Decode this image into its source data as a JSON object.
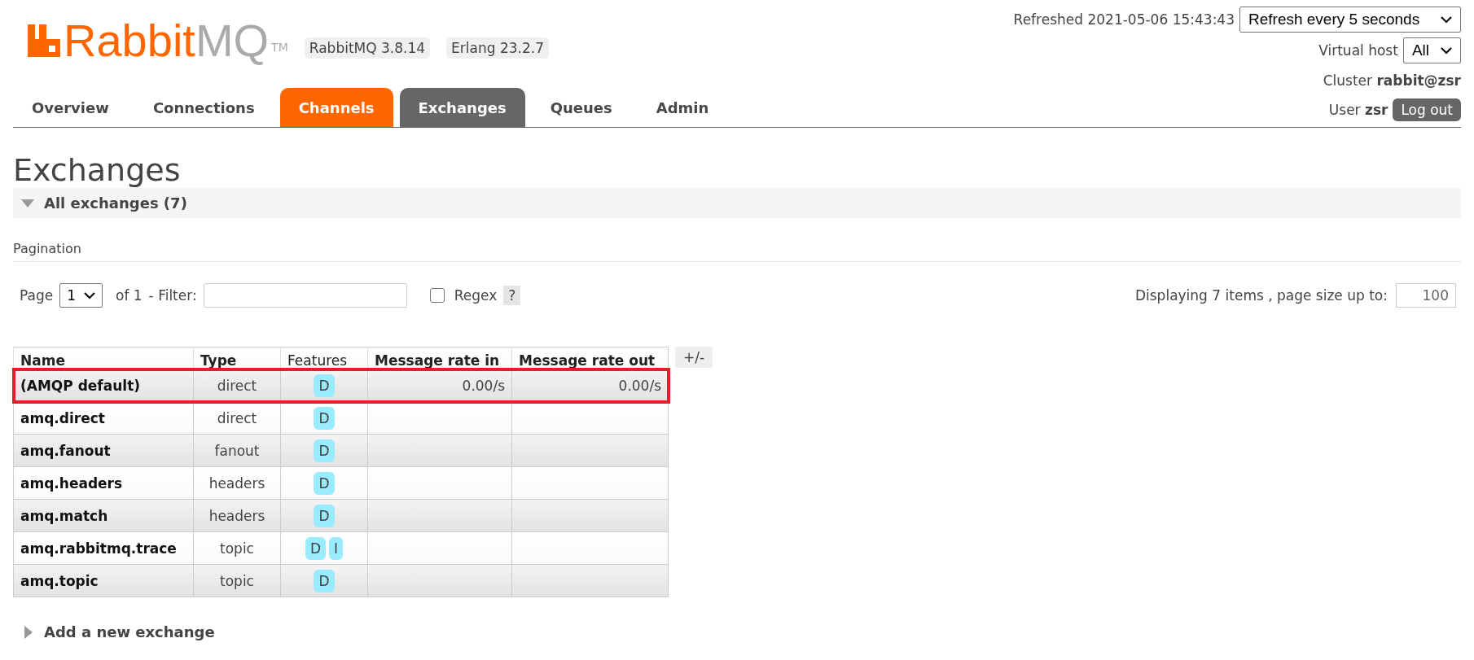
{
  "header": {
    "logo": {
      "brand": "Rabbit",
      "suffix": "MQ",
      "tm": "TM"
    },
    "versions": [
      "RabbitMQ 3.8.14",
      "Erlang 23.2.7"
    ],
    "refreshed": "Refreshed 2021-05-06 15:43:43",
    "refresh_select": "Refresh every 5 seconds",
    "virtual_host": {
      "label": "Virtual host",
      "value": "All"
    },
    "cluster": {
      "label": "Cluster",
      "value": "rabbit@zsr"
    },
    "user": {
      "label": "User",
      "value": "zsr"
    },
    "logout": "Log out"
  },
  "tabs": [
    {
      "label": "Overview",
      "selected": false,
      "hover": false
    },
    {
      "label": "Connections",
      "selected": false,
      "hover": false
    },
    {
      "label": "Channels",
      "selected": false,
      "hover": true
    },
    {
      "label": "Exchanges",
      "selected": true,
      "hover": false
    },
    {
      "label": "Queues",
      "selected": false,
      "hover": false
    },
    {
      "label": "Admin",
      "selected": false,
      "hover": false
    }
  ],
  "page_title": "Exchanges",
  "section": {
    "title": "All exchanges (7)",
    "expanded": true
  },
  "pagination": {
    "title": "Pagination",
    "page_label": "Page",
    "page": "1",
    "of": "of 1",
    "filter_label": "- Filter:",
    "regex_checked": false,
    "regex_label": "Regex",
    "help": "?",
    "displaying": "Displaying 7 items , page size up to:",
    "page_size": "100"
  },
  "table": {
    "columns": [
      "Name",
      "Type",
      "Features",
      "Message rate in",
      "Message rate out"
    ],
    "toggle": "+/-",
    "rows": [
      {
        "name": "(AMQP default)",
        "type": "direct",
        "features": [
          "D"
        ],
        "rate_in": "0.00/s",
        "rate_out": "0.00/s",
        "highlighted": true
      },
      {
        "name": "amq.direct",
        "type": "direct",
        "features": [
          "D"
        ],
        "highlighted": false
      },
      {
        "name": "amq.fanout",
        "type": "fanout",
        "features": [
          "D"
        ],
        "highlighted": false
      },
      {
        "name": "amq.headers",
        "type": "headers",
        "features": [
          "D"
        ],
        "highlighted": false
      },
      {
        "name": "amq.match",
        "type": "headers",
        "features": [
          "D"
        ],
        "highlighted": false
      },
      {
        "name": "amq.rabbitmq.trace",
        "type": "topic",
        "features": [
          "D",
          "I"
        ],
        "highlighted": false
      },
      {
        "name": "amq.topic",
        "type": "topic",
        "features": [
          "D"
        ],
        "highlighted": false
      }
    ]
  },
  "add_section": {
    "title": "Add a new exchange",
    "expanded": false
  }
}
